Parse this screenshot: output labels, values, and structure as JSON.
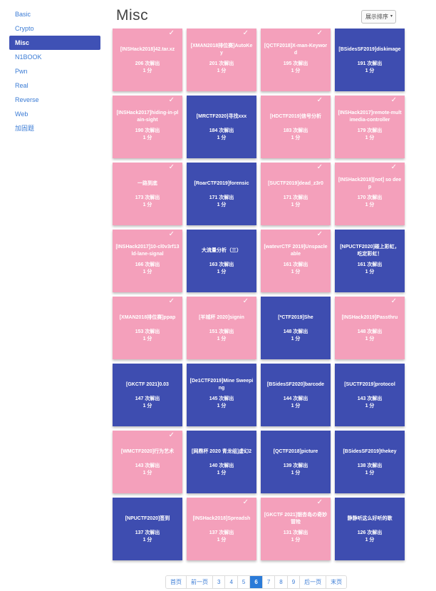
{
  "sidebar": {
    "items": [
      {
        "label": "Basic",
        "active": false
      },
      {
        "label": "Crypto",
        "active": false
      },
      {
        "label": "Misc",
        "active": true
      },
      {
        "label": "N1BOOK",
        "active": false
      },
      {
        "label": "Pwn",
        "active": false
      },
      {
        "label": "Real",
        "active": false
      },
      {
        "label": "Reverse",
        "active": false
      },
      {
        "label": "Web",
        "active": false
      },
      {
        "label": "加固题",
        "active": false
      }
    ]
  },
  "page": {
    "title": "Misc",
    "sort_label": "展示排序",
    "sort_caret": "▾"
  },
  "colors": {
    "pink": "#f4a0bb",
    "blue": "#3e4db0",
    "sidebar_active": "#3f51b5",
    "pagination_active": "#2b7bd8"
  },
  "card_icon": "check-icon",
  "challenges": [
    {
      "title": "[INSHack2018]42.tar.xz",
      "solves": "206 次解出",
      "score": "1 分",
      "color": "pink",
      "solved": true
    },
    {
      "title": "[XMAN2018排位赛]AutoKey",
      "solves": "201 次解出",
      "score": "1 分",
      "color": "pink",
      "solved": true
    },
    {
      "title": "[QCTF2018]X-man-Keyword",
      "solves": "195 次解出",
      "score": "1 分",
      "color": "pink",
      "solved": true
    },
    {
      "title": "[BSidesSF2019]diskimage",
      "solves": "191 次解出",
      "score": "1 分",
      "color": "blue",
      "solved": false
    },
    {
      "title": "[INSHack2017]hiding-in-plain-sight",
      "solves": "190 次解出",
      "score": "1 分",
      "color": "pink",
      "solved": true
    },
    {
      "title": "[MRCTF2020]寻找xxx",
      "solves": "184 次解出",
      "score": "1 分",
      "color": "blue",
      "solved": false
    },
    {
      "title": "[HDCTF2019]信号分析",
      "solves": "183 次解出",
      "score": "1 分",
      "color": "pink",
      "solved": true
    },
    {
      "title": "[INSHack2017]remote-multimedia-controller",
      "solves": "179 次解出",
      "score": "1 分",
      "color": "pink",
      "solved": true
    },
    {
      "title": "一路到底",
      "solves": "173 次解出",
      "score": "1 分",
      "color": "pink",
      "solved": true
    },
    {
      "title": "[RoarCTF2019]forensic",
      "solves": "171 次解出",
      "score": "1 分",
      "color": "blue",
      "solved": false
    },
    {
      "title": "[SUCTF2019]dead_z3r0",
      "solves": "171 次解出",
      "score": "1 分",
      "color": "pink",
      "solved": true
    },
    {
      "title": "[INSHack2018][not] so deep",
      "solves": "170 次解出",
      "score": "1 分",
      "color": "pink",
      "solved": true
    },
    {
      "title": "[INSHack2017]10-cl0v3rf13ld-lane-signal",
      "solves": "166 次解出",
      "score": "1 分",
      "color": "pink",
      "solved": true
    },
    {
      "title": "大流量分析（三）",
      "solves": "163 次解出",
      "score": "1 分",
      "color": "blue",
      "solved": false
    },
    {
      "title": "[watevrCTF 2019]Unspacleable",
      "solves": "161 次解出",
      "score": "1 分",
      "color": "pink",
      "solved": true
    },
    {
      "title": "[NPUCTF2020]碰上彩虹，吃定彩虹！",
      "solves": "161 次解出",
      "score": "1 分",
      "color": "blue",
      "solved": false
    },
    {
      "title": "[XMAN2018排位赛]ppap",
      "solves": "153 次解出",
      "score": "1 分",
      "color": "pink",
      "solved": true
    },
    {
      "title": "[羊城杯 2020]signin",
      "solves": "151 次解出",
      "score": "1 分",
      "color": "pink",
      "solved": true
    },
    {
      "title": "[*CTF2019]She",
      "solves": "148 次解出",
      "score": "1 分",
      "color": "blue",
      "solved": false
    },
    {
      "title": "[INSHack2019]Passthru",
      "solves": "148 次解出",
      "score": "1 分",
      "color": "pink",
      "solved": true
    },
    {
      "title": "[GKCTF 2021]0.03",
      "solves": "147 次解出",
      "score": "1 分",
      "color": "blue",
      "solved": false
    },
    {
      "title": "[De1CTF2019]Mine Sweeping",
      "solves": "145 次解出",
      "score": "1 分",
      "color": "blue",
      "solved": false
    },
    {
      "title": "[BSidesSF2020]barcode",
      "solves": "144 次解出",
      "score": "1 分",
      "color": "blue",
      "solved": false
    },
    {
      "title": "[SUCTF2019]protocol",
      "solves": "143 次解出",
      "score": "1 分",
      "color": "blue",
      "solved": false
    },
    {
      "title": "[WMCTF2020]行为艺术",
      "solves": "143 次解出",
      "score": "1 分",
      "color": "pink",
      "solved": true
    },
    {
      "title": "[网鼎杯 2020 青龙组]虚幻2",
      "solves": "140 次解出",
      "score": "1 分",
      "color": "blue",
      "solved": false
    },
    {
      "title": "[QCTF2018]picture",
      "solves": "139 次解出",
      "score": "1 分",
      "color": "blue",
      "solved": false
    },
    {
      "title": "[BSidesSF2019]thekey",
      "solves": "138 次解出",
      "score": "1 分",
      "color": "blue",
      "solved": false
    },
    {
      "title": "[NPUCTF2020]签到",
      "solves": "137 次解出",
      "score": "1 分",
      "color": "blue",
      "solved": false
    },
    {
      "title": "[INSHack2018]Spreadsh",
      "solves": "137 次解出",
      "score": "1 分",
      "color": "pink",
      "solved": true
    },
    {
      "title": "[GKCTF 2021]银杏岛の奇妙冒险",
      "solves": "131 次解出",
      "score": "1 分",
      "color": "pink",
      "solved": true
    },
    {
      "title": "静静听这么好听的歌",
      "solves": "126 次解出",
      "score": "1 分",
      "color": "blue",
      "solved": false
    }
  ],
  "pagination": {
    "items": [
      {
        "label": "首页",
        "active": false
      },
      {
        "label": "前一页",
        "active": false
      },
      {
        "label": "3",
        "active": false
      },
      {
        "label": "4",
        "active": false
      },
      {
        "label": "5",
        "active": false
      },
      {
        "label": "6",
        "active": true
      },
      {
        "label": "7",
        "active": false
      },
      {
        "label": "8",
        "active": false
      },
      {
        "label": "9",
        "active": false
      },
      {
        "label": "后一页",
        "active": false
      },
      {
        "label": "末页",
        "active": false
      }
    ]
  }
}
